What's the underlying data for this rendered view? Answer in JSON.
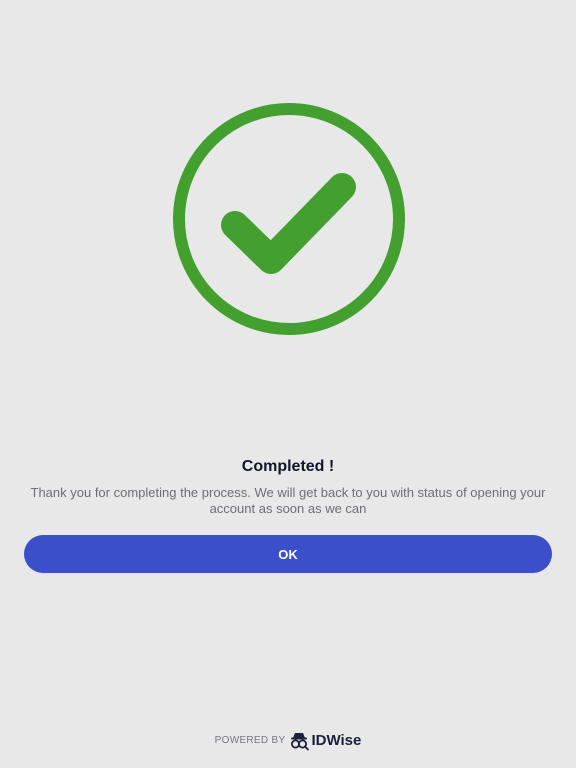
{
  "status": {
    "icon": "checkmark-circle-icon",
    "color": "#43a02f",
    "title": "Completed !",
    "message": "Thank you for completing the process. We will get back to you with status of opening your account as soon as we can"
  },
  "actions": {
    "ok_label": "OK",
    "button_color": "#3a4fc9"
  },
  "footer": {
    "powered_by": "POWERED BY",
    "brand_icon": "idwise-logo-icon",
    "brand": "IDWise"
  }
}
